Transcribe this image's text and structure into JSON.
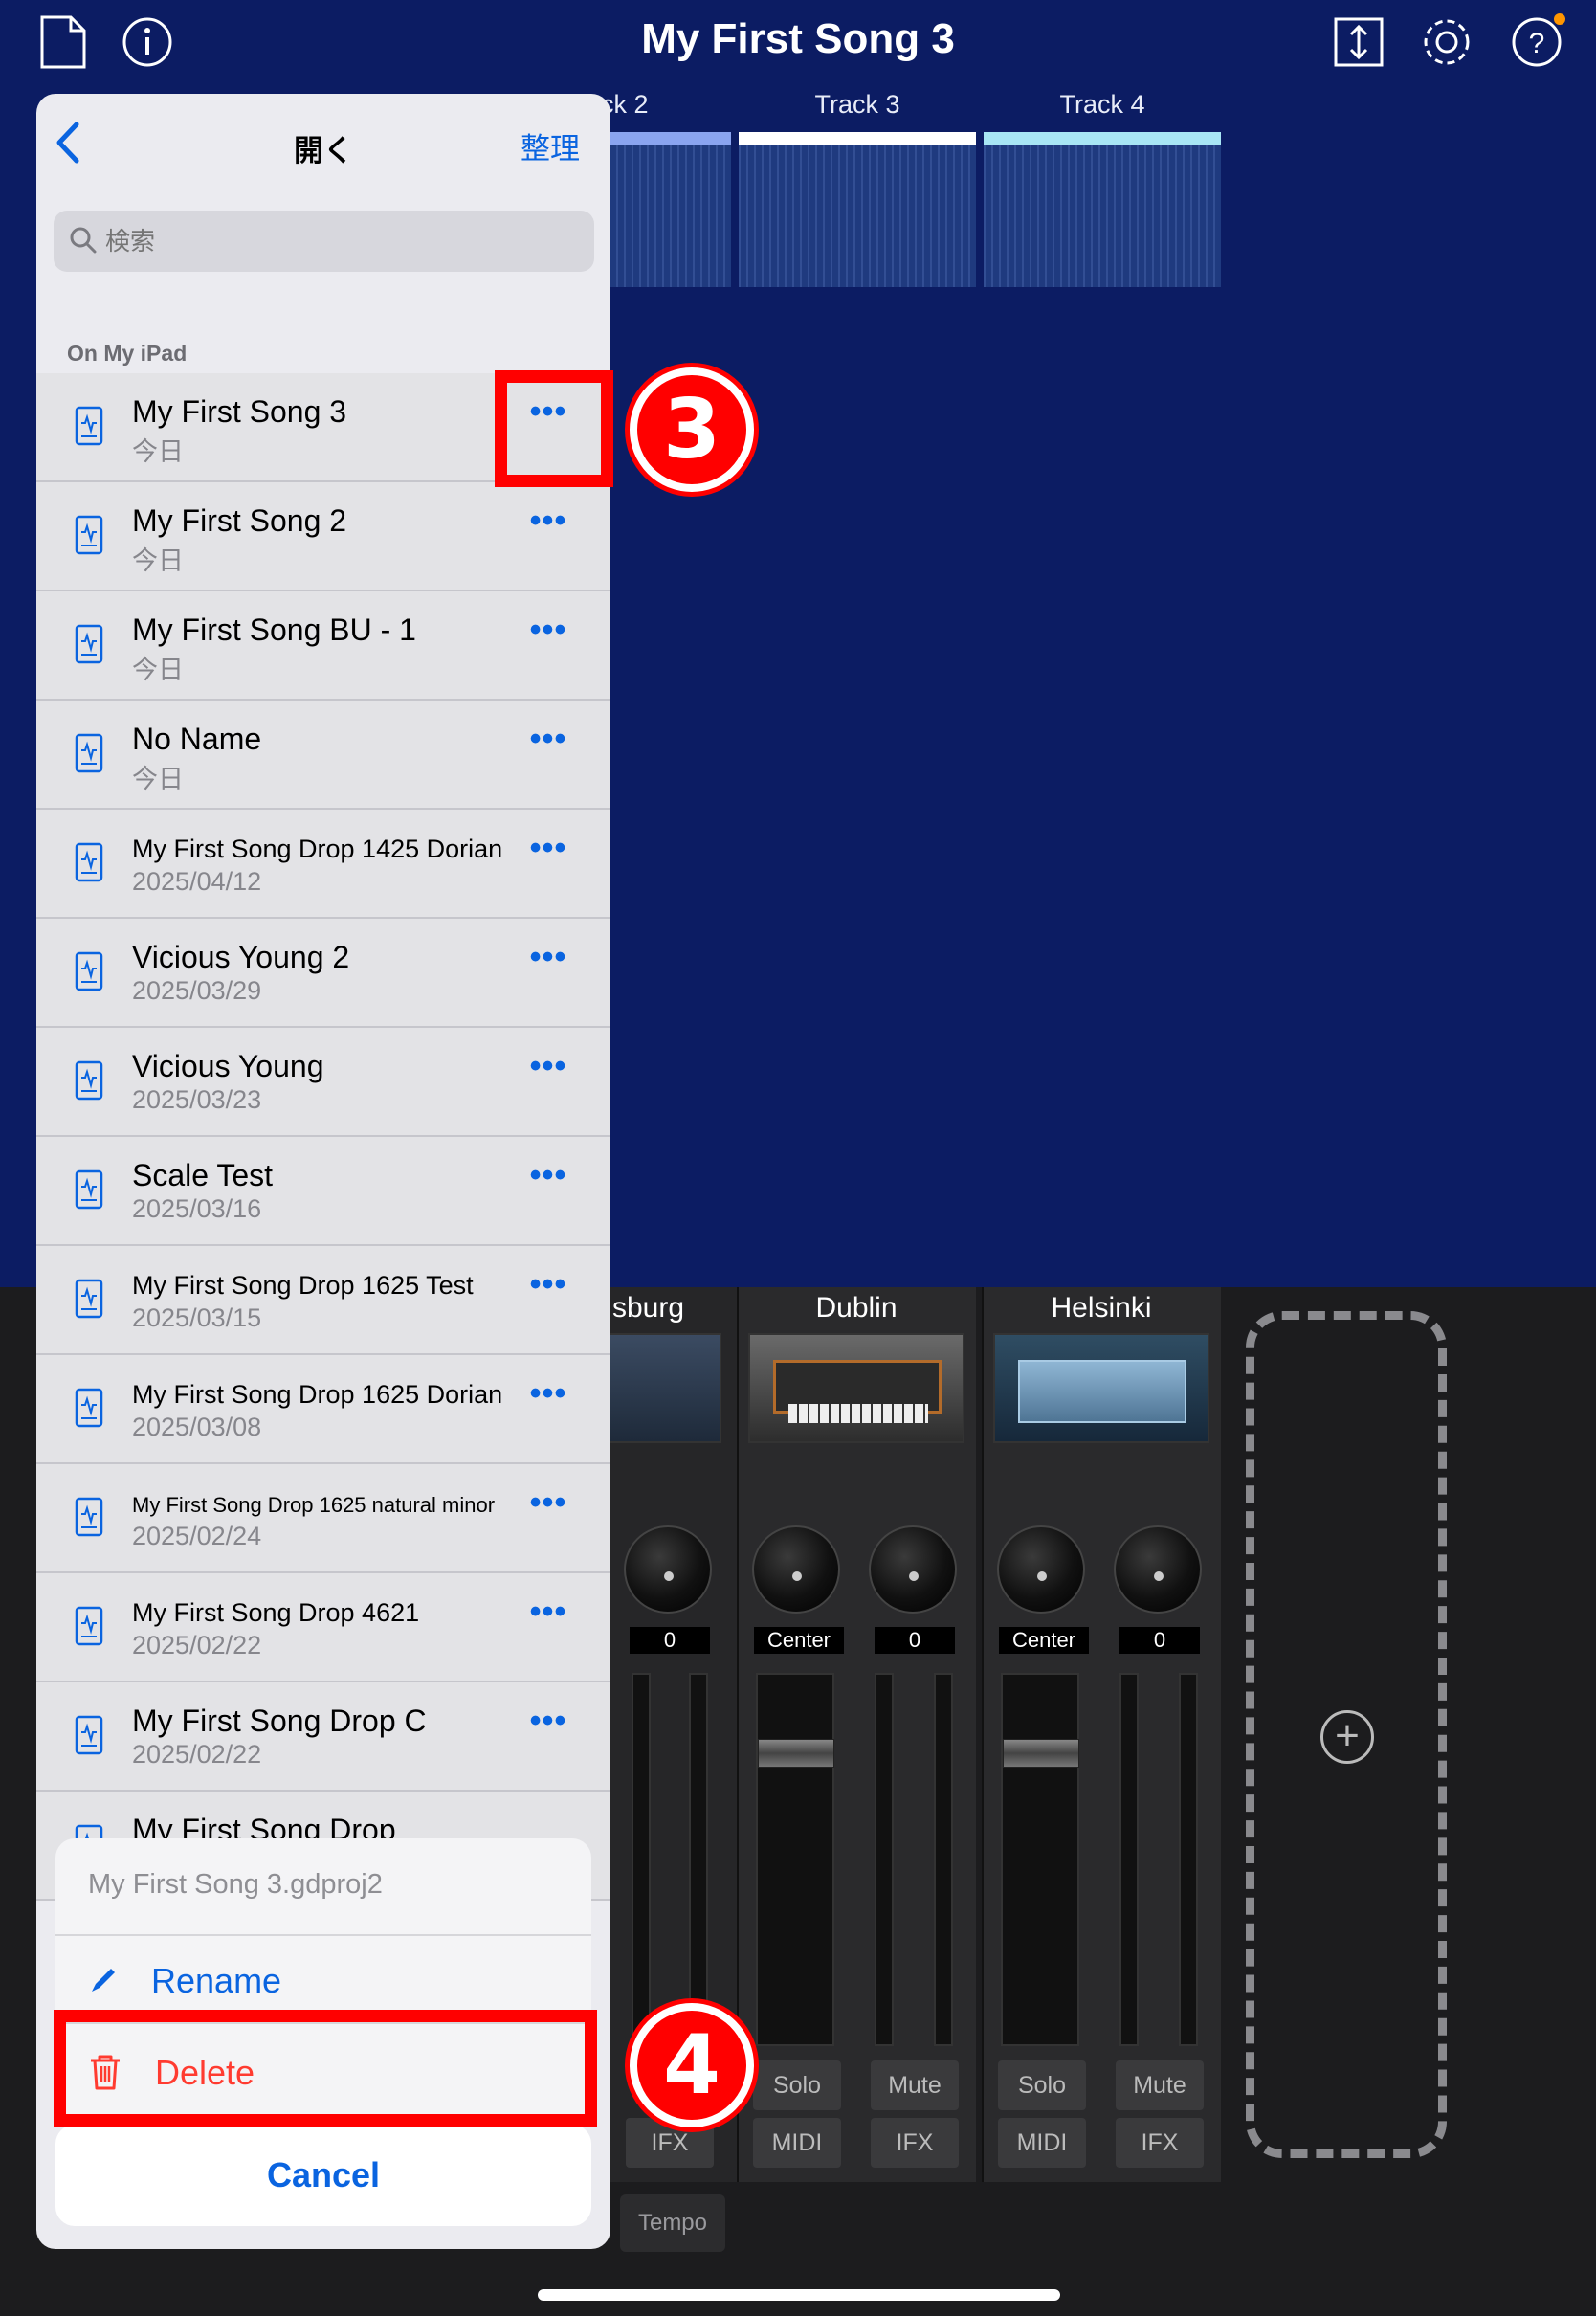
{
  "app": {
    "title": "My First Song 3",
    "toolbar_icons": [
      "document-icon",
      "info-icon",
      "export-icon",
      "settings-gear-icon",
      "help-icon"
    ]
  },
  "tracks": [
    {
      "label": "ck 2",
      "color": "#8aa4f0"
    },
    {
      "label": "Track 3",
      "color": "#ffffff"
    },
    {
      "label": "Track 4",
      "color": "#a8e6f5"
    }
  ],
  "mixer": {
    "channels": [
      {
        "name": "sburg",
        "pan": "",
        "level": "0"
      },
      {
        "name": "Dublin",
        "pan": "Center",
        "level": "0",
        "solo": "Solo",
        "mute": "Mute",
        "midi": "MIDI",
        "ifx": "IFX"
      },
      {
        "name": "Helsinki",
        "pan": "Center",
        "level": "0",
        "solo": "Solo",
        "mute": "Mute",
        "midi": "MIDI",
        "ifx": "IFX"
      }
    ],
    "partial_ifx": "IFX",
    "tempo_label": "Tempo"
  },
  "popover": {
    "title": "開く",
    "organize": "整理",
    "search_placeholder": "検索",
    "section_header": "On My iPad",
    "files": [
      {
        "name": "My First Song 3",
        "date": "今日"
      },
      {
        "name": "My First Song 2",
        "date": "今日"
      },
      {
        "name": "My First Song BU - 1",
        "date": "今日"
      },
      {
        "name": "No Name",
        "date": "今日"
      },
      {
        "name": "My First Song Drop 1425 Dorian",
        "date": "2025/04/12"
      },
      {
        "name": "Vicious Young 2",
        "date": "2025/03/29"
      },
      {
        "name": "Vicious Young",
        "date": "2025/03/23"
      },
      {
        "name": "Scale Test",
        "date": "2025/03/16"
      },
      {
        "name": "My First Song Drop 1625 Test",
        "date": "2025/03/15"
      },
      {
        "name": "My First Song Drop 1625 Dorian",
        "date": "2025/03/08"
      },
      {
        "name": "My First Song Drop 1625 natural minor",
        "date": "2025/02/24"
      },
      {
        "name": "My First Song Drop 4621",
        "date": "2025/02/22"
      },
      {
        "name": "My First Song Drop C",
        "date": "2025/02/22"
      },
      {
        "name": "My First Song Drop",
        "date": ""
      }
    ],
    "more_glyph": "•••"
  },
  "action_sheet": {
    "filename": "My First Song 3.gdproj2",
    "rename": "Rename",
    "delete": "Delete",
    "cancel": "Cancel"
  },
  "annotations": {
    "step3": "3",
    "step4": "4",
    "color": "#ff0000"
  }
}
